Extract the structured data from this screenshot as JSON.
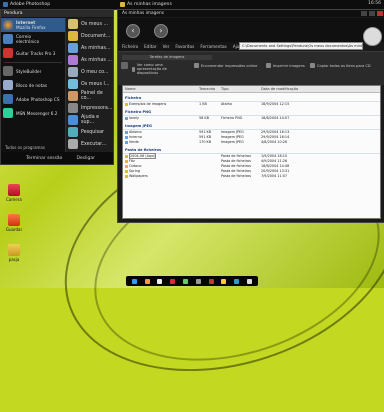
{
  "taskbar": {
    "tasks": [
      {
        "label": "Adobe Photoshop",
        "icon": "photoshop-icon"
      },
      {
        "label": "As minhas imagens",
        "icon": "folder-icon"
      }
    ],
    "clock": "16:56"
  },
  "start_menu": {
    "user": "Pendura",
    "pinned": [
      {
        "title": "Internet",
        "sub": "Mozilla Firefox"
      },
      {
        "title": "Correio",
        "sub": "electrónico"
      },
      {
        "title": "Guitar Tracks Pro 3",
        "sub": ""
      },
      {
        "title": "StyleBuilder",
        "sub": ""
      },
      {
        "title": "Bloco de notas",
        "sub": ""
      },
      {
        "title": "Adobe Photoshop CS",
        "sub": ""
      },
      {
        "title": "MSN Messenger 6.2",
        "sub": ""
      }
    ],
    "places": [
      "Os meus ...",
      "Document...",
      "As minhas...",
      "As minhas ...",
      "O meu co...",
      "Os meus l...",
      "Painel de co...",
      "Impressora...",
      "Ajuda e sup...",
      "Pesquisar",
      "Executar..."
    ],
    "all_programs": "Todos os programas",
    "logoff": "Terminar sessão",
    "shutdown": "Desligar"
  },
  "explorer": {
    "title": "As minhas imagens",
    "address": "C:\\Documents and Settings\\Pendura\\Os meus documentos\\As minhas imagens",
    "menu": [
      "Ficheiro",
      "Editar",
      "Ver",
      "Favoritos",
      "Ferramentas",
      "Ajuda"
    ],
    "tasks_title": "Tarefas de imagens",
    "toolbar": [
      "Ver como uma apresentação de diapositivos",
      "Encomendar impressões online",
      "Imprimir imagens",
      "Copiar todos os itens para CD"
    ],
    "columns": [
      "Nome",
      "Tamanho",
      "Tipo",
      "Data de modificação"
    ],
    "groups": [
      {
        "name": "Ficheiro",
        "rows": [
          {
            "name": "Exemplos de imagens",
            "size": "1 KB",
            "type": "Atalho",
            "date": "18/9/2004 12:15"
          }
        ]
      },
      {
        "name": "Ficheiro PNG",
        "rows": [
          {
            "name": "lovely",
            "size": "58 KB",
            "type": "Ficheiro PNG",
            "date": "18/8/2004 14:07"
          }
        ]
      },
      {
        "name": "Imagem JPEG",
        "rows": [
          {
            "name": "Abismo",
            "size": "591 KB",
            "type": "Imagem JPEG",
            "date": "29/9/2004 16:13"
          },
          {
            "name": "Inverno",
            "size": "591 KB",
            "type": "Imagem JPEG",
            "date": "29/9/2004 16:14"
          },
          {
            "name": "Verde",
            "size": "170 KB",
            "type": "Imagem JPEG",
            "date": "4/8/2004 10:26"
          }
        ]
      },
      {
        "name": "Pasta de ficheiros",
        "rows": [
          {
            "name": "2004-06 (Aqui)",
            "size": "",
            "type": "Pasta de ficheiros",
            "date": "1/9/2004 18:10"
          },
          {
            "name": "Fitz",
            "size": "",
            "type": "Pasta de ficheiros",
            "date": "4/9/2004 11:26"
          },
          {
            "name": "Outono",
            "size": "",
            "type": "Pasta de ficheiros",
            "date": "18/8/2004 14:48"
          },
          {
            "name": "Spring",
            "size": "",
            "type": "Pasta de ficheiros",
            "date": "20/9/2004 13:31"
          },
          {
            "name": "Wallpapers",
            "size": "",
            "type": "Pasta de ficheiros",
            "date": "7/9/2004 11:07"
          }
        ]
      }
    ]
  },
  "desktop_icons": [
    {
      "label": "Camera",
      "icon": "camera-icon"
    },
    {
      "label": "Guardar",
      "icon": "save-icon"
    },
    {
      "label": "pasja",
      "icon": "folder-icon"
    }
  ],
  "colors": {
    "desktop": "#c3d820",
    "panel": "#141414",
    "selection": "#2e5a8e",
    "group_header": "#1a3c78"
  }
}
